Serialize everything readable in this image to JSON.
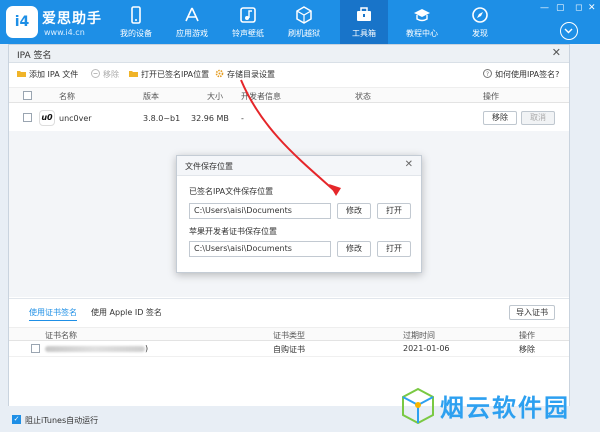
{
  "brand": {
    "name": "爱思助手",
    "url": "www.i4.cn",
    "logo_text": "i4"
  },
  "nav": [
    {
      "label": "我的设备",
      "icon": "phone-icon"
    },
    {
      "label": "应用游戏",
      "icon": "appstore-icon"
    },
    {
      "label": "铃声壁纸",
      "icon": "music-icon"
    },
    {
      "label": "刷机越狱",
      "icon": "box-icon"
    },
    {
      "label": "工具箱",
      "icon": "toolbox-icon",
      "active": true
    },
    {
      "label": "教程中心",
      "icon": "graduation-cap-icon"
    },
    {
      "label": "发现",
      "icon": "compass-icon"
    }
  ],
  "window": {
    "title": "IPA 签名",
    "toolbar": {
      "add": "添加 IPA 文件",
      "remove": "移除",
      "open_signed": "打开已签名IPA位置",
      "storage": "存储目录设置",
      "help": "如何使用IPA签名?"
    },
    "columns": {
      "name": "名称",
      "version": "版本",
      "size": "大小",
      "developer": "开发者信息",
      "status": "状态",
      "action": "操作"
    },
    "rows": [
      {
        "name": "unc0ver",
        "version": "3.8.0~b1",
        "size": "32.96 MB",
        "developer": "-",
        "remove": "移除",
        "cancel": "取消"
      }
    ]
  },
  "cert": {
    "tab_cert": "使用证书签名",
    "tab_appleid": "使用 Apple ID 签名",
    "import": "导入证书",
    "columns": {
      "name": "证书名称",
      "type": "证书类型",
      "expire": "过期时间",
      "action": "操作"
    },
    "rows": [
      {
        "name_suffix": ")",
        "type": "自购证书",
        "expire": "2021-01-06",
        "action": "移除"
      }
    ]
  },
  "dialog": {
    "title": "文件保存位置",
    "signed_label": "已签名IPA文件保存位置",
    "signed_path": "C:\\Users\\aisi\\Documents",
    "cert_label": "苹果开发者证书保存位置",
    "cert_path": "C:\\Users\\aisi\\Documents",
    "modify": "修改",
    "open": "打开"
  },
  "status": {
    "itunes_block": "阻止iTunes自动运行"
  },
  "watermark": {
    "text": "烟云软件园"
  },
  "colors": {
    "primary": "#1e8fe6",
    "arrow": "#e5262a"
  }
}
